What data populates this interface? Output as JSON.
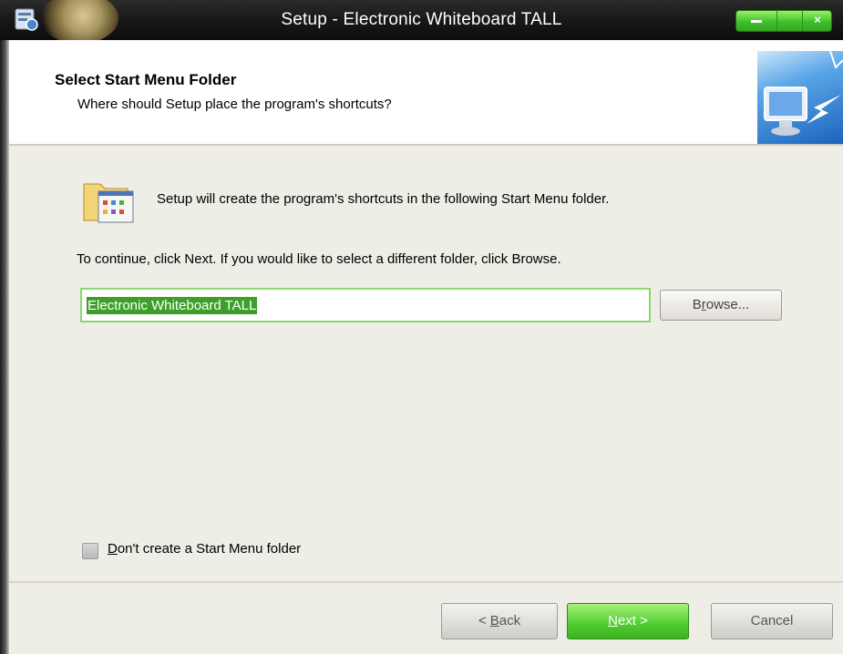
{
  "window": {
    "title": "Setup - Electronic Whiteboard TALL"
  },
  "header": {
    "title": "Select Start Menu Folder",
    "subtitle": "Where should Setup place the program's shortcuts?"
  },
  "body": {
    "info": "Setup will create the program's shortcuts in the following Start Menu folder.",
    "continue": "To continue, click Next. If you would like to select a different folder, click Browse.",
    "folder_value": "Electronic Whiteboard TALL",
    "browse": {
      "pre": "B",
      "key": "r",
      "post": "owse..."
    },
    "no_folder": {
      "key": "D",
      "post": "on't create a Start Menu folder",
      "checked": false
    }
  },
  "footer": {
    "back": {
      "pre": "< ",
      "key": "B",
      "post": "ack"
    },
    "next": {
      "key": "N",
      "post": "ext >"
    },
    "cancel": "Cancel"
  },
  "colors": {
    "accent_green": "#3d9f2a",
    "title_bar": "#1a1a1a"
  },
  "icons": [
    "setup-app-icon",
    "start-menu-folder-icon",
    "computer-shortcut-icon",
    "minimize-icon",
    "maximize-icon",
    "close-icon"
  ]
}
